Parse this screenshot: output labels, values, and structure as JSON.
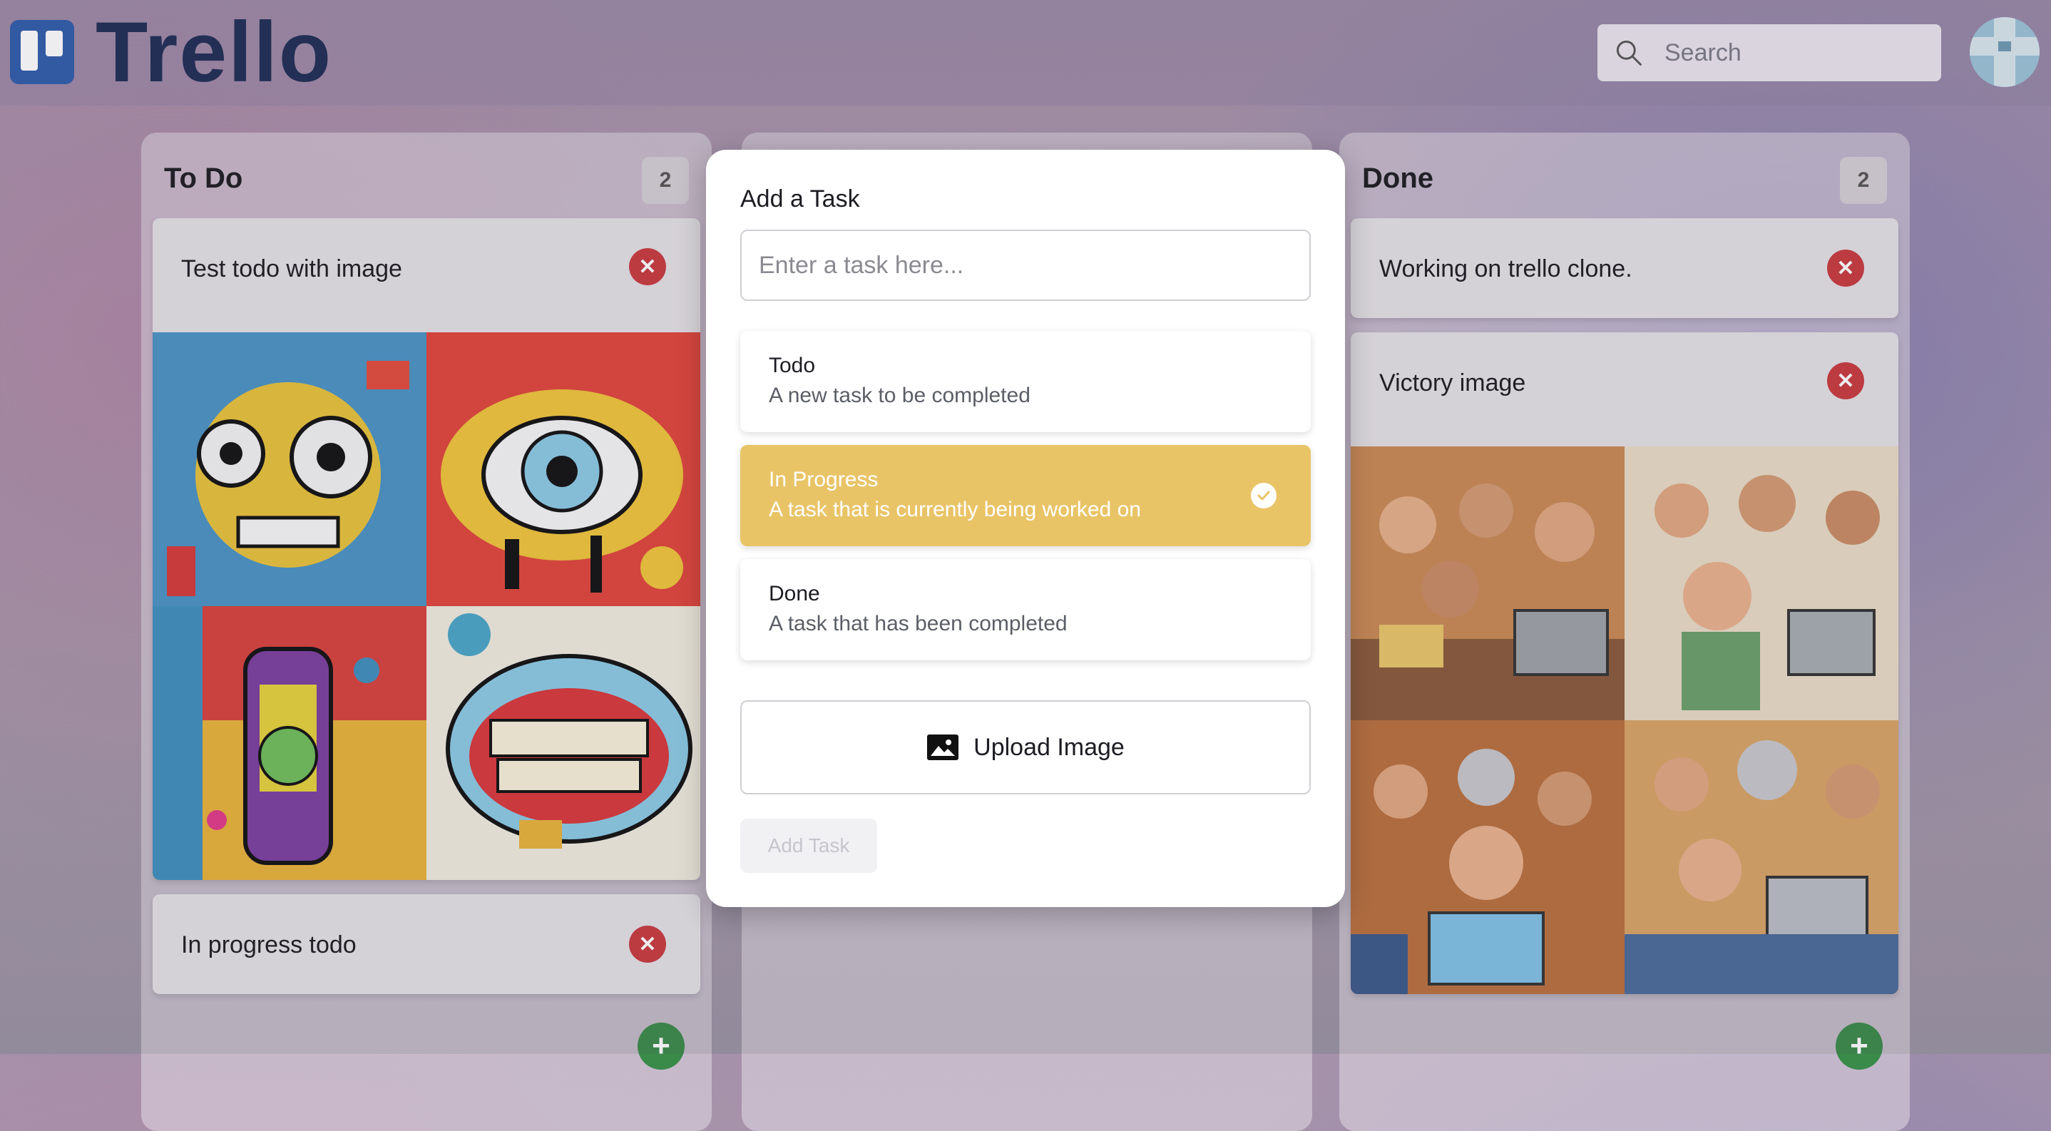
{
  "header": {
    "logo_text": "Trello",
    "search_placeholder": "Search"
  },
  "columns": [
    {
      "title": "To Do",
      "count": "2",
      "cards": [
        {
          "title": "Test todo with image",
          "has_image": true
        },
        {
          "title": "In progress todo",
          "has_image": false
        }
      ]
    },
    {
      "title": "",
      "count": "",
      "cards": []
    },
    {
      "title": "Done",
      "count": "2",
      "cards": [
        {
          "title": "Working on trello clone.",
          "has_image": false
        },
        {
          "title": "Victory image",
          "has_image": true
        }
      ]
    }
  ],
  "modal": {
    "title": "Add a Task",
    "input_placeholder": "Enter a task here...",
    "input_value": "",
    "options": [
      {
        "label": "Todo",
        "description": "A new task to be completed",
        "selected": false
      },
      {
        "label": "In Progress",
        "description": "A task that is currently being worked on",
        "selected": true
      },
      {
        "label": "Done",
        "description": "A task that has been completed",
        "selected": false
      }
    ],
    "upload_label": "Upload Image",
    "submit_label": "Add Task"
  },
  "colors": {
    "brand": "#2f5dab",
    "logo_text": "#1f2d55",
    "delete": "#c83a3f",
    "add": "#3a8a4a",
    "selected_option": "#e9c467"
  },
  "icons": {
    "search": "search-icon",
    "delete": "close-icon",
    "add": "plus-icon",
    "check": "check-icon",
    "upload": "image-icon"
  }
}
